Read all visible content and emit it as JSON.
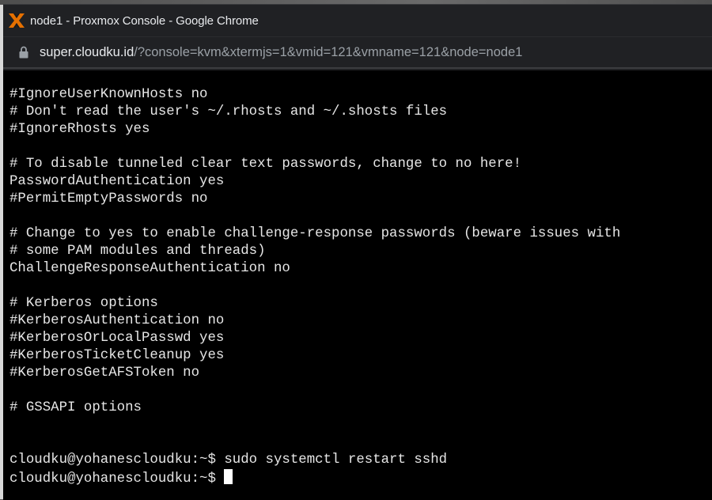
{
  "window": {
    "title": "node1 - Proxmox Console - Google Chrome",
    "app_icon": "proxmox-logo-icon"
  },
  "address_bar": {
    "lock_icon": "lock-icon",
    "host": "super.cloudku.id",
    "path": "/?console=kvm&xtermjs=1&vmid=121&vmname=121&node=node1"
  },
  "terminal": {
    "lines": [
      "#IgnoreUserKnownHosts no",
      "# Don't read the user's ~/.rhosts and ~/.shosts files",
      "#IgnoreRhosts yes",
      "",
      "# To disable tunneled clear text passwords, change to no here!",
      "PasswordAuthentication yes",
      "#PermitEmptyPasswords no",
      "",
      "# Change to yes to enable challenge-response passwords (beware issues with",
      "# some PAM modules and threads)",
      "ChallengeResponseAuthentication no",
      "",
      "# Kerberos options",
      "#KerberosAuthentication no",
      "#KerberosOrLocalPasswd yes",
      "#KerberosTicketCleanup yes",
      "#KerberosGetAFSToken no",
      "",
      "# GSSAPI options",
      "",
      "",
      "cloudku@yohanescloudku:~$ sudo systemctl restart sshd"
    ],
    "prompt": "cloudku@yohanescloudku:~$ "
  }
}
